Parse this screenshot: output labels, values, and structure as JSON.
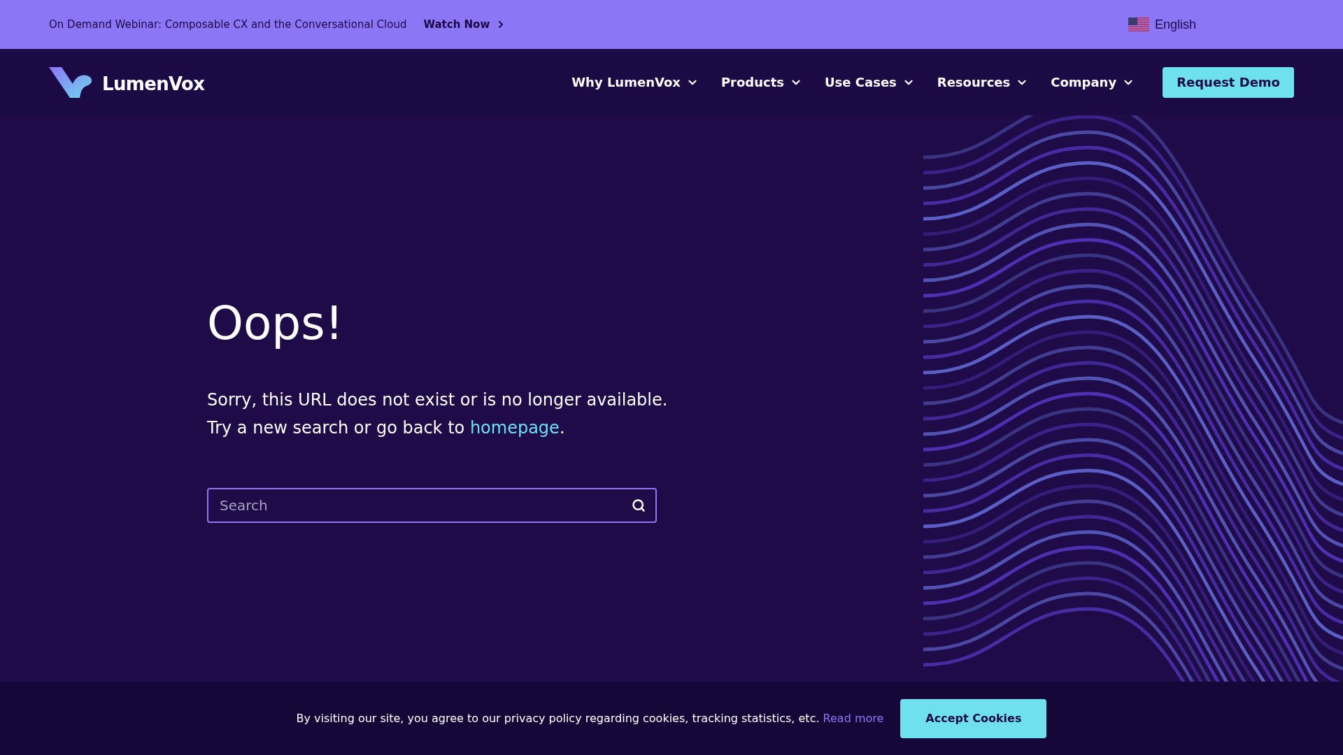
{
  "announcement": {
    "text": "On Demand Webinar: Composable CX and the Conversational Cloud",
    "link": "Watch Now",
    "language": "English"
  },
  "nav": {
    "logo": "LumenVox",
    "items": [
      {
        "label": "Why LumenVox"
      },
      {
        "label": "Products"
      },
      {
        "label": "Use Cases"
      },
      {
        "label": "Resources"
      },
      {
        "label": "Company"
      }
    ],
    "cta": "Request Demo"
  },
  "error": {
    "title": "Oops!",
    "line_1": "Sorry, this URL does not exist or is no longer available.",
    "line_2": "Try a new search or go back to",
    "link": "homepage",
    "line_2_end": "."
  },
  "search": {
    "placeholder": "Search"
  },
  "cookie_bar": {
    "text": "By visiting our site, you agree to our privacy policy regarding cookies, tracking statistics, etc.",
    "link": "Read more",
    "button": "Accept Cookies"
  }
}
